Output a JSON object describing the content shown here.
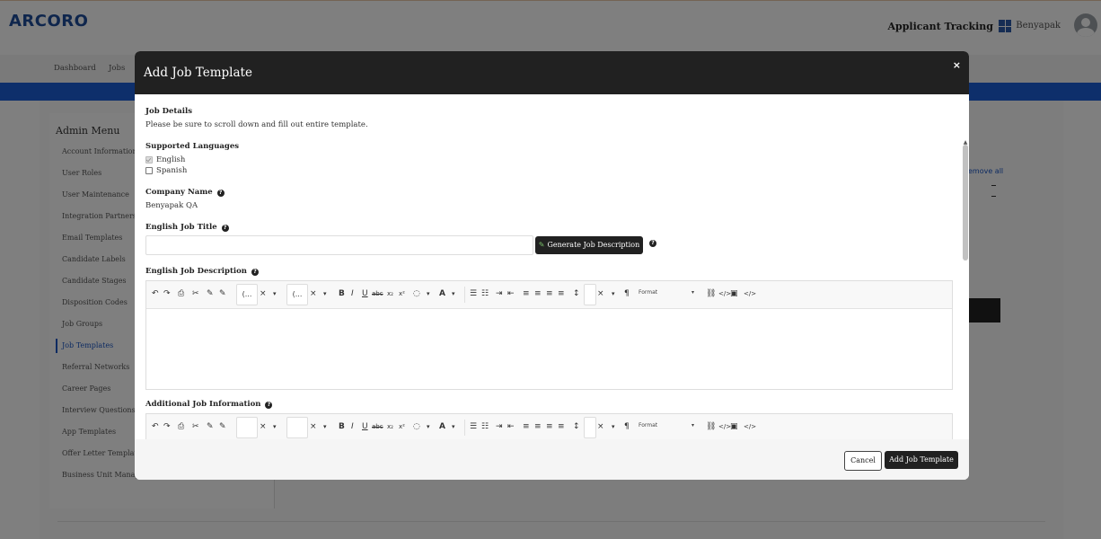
{
  "header": {
    "logo": "ARCORO",
    "app_title": "Applicant Tracking",
    "user_name": "Benyapak"
  },
  "nav": {
    "items": [
      "Dashboard",
      "Jobs"
    ]
  },
  "admin_menu": {
    "title": "Admin Menu",
    "items": [
      "Account Information",
      "User Roles",
      "User Maintenance",
      "Integration Partners",
      "Email Templates",
      "Candidate Labels",
      "Candidate Stages",
      "Disposition Codes",
      "Job Groups",
      "Job Templates",
      "Referral Networks",
      "Career Pages",
      "Interview Questions",
      "App Templates",
      "Offer Letter Templates",
      "Business Unit Manag..."
    ],
    "active": "Job Templates"
  },
  "background": {
    "remove_all": "emove all"
  },
  "modal": {
    "title": "Add Job Template",
    "close": "×",
    "job_details_label": "Job Details",
    "job_details_text": "Please be sure to scroll down and fill out entire template.",
    "languages_label": "Supported Languages",
    "languages": [
      {
        "name": "English",
        "checked": true
      },
      {
        "name": "Spanish",
        "checked": false
      }
    ],
    "company_label": "Company Name",
    "company_value": "Benyapak QA",
    "title_label": "English Job Title",
    "title_value": "",
    "generate_button": "Generate Job Description",
    "description_label": "English Job Description",
    "additional_label": "Additional Job Information",
    "cancel_button": "Cancel",
    "submit_button": "Add Job Template"
  },
  "editor_toolbar": {
    "undo": "↶",
    "redo": "↷",
    "print": "⎙",
    "font_box": "(...",
    "size_box": "(...",
    "clear": "×",
    "dropdown": "▾",
    "bold": "B",
    "italic": "I",
    "underline": "U",
    "strike": "abc",
    "subscript": "x₂",
    "superscript": "x²",
    "color_a": "A",
    "paragraph": "¶",
    "format": "Format",
    "code": "</>"
  },
  "help_icon": "?"
}
